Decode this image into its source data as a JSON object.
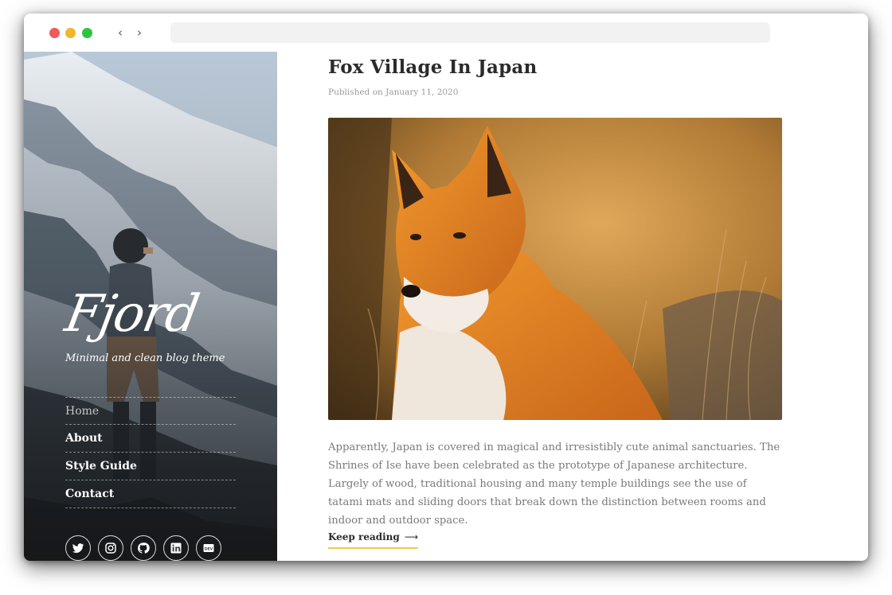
{
  "browser": {
    "back_icon": "chevron-left-icon",
    "forward_icon": "chevron-right-icon",
    "traffic_lights": [
      "#ee5b5a",
      "#f2b62b",
      "#2ec343"
    ]
  },
  "sidebar": {
    "logo": "Fjord",
    "tagline": "Minimal and clean blog theme",
    "menu": [
      {
        "label": "Home",
        "active": true
      },
      {
        "label": "About",
        "active": false
      },
      {
        "label": "Style Guide",
        "active": false
      },
      {
        "label": "Contact",
        "active": false
      }
    ],
    "socials": [
      "twitter-icon",
      "instagram-icon",
      "github-icon",
      "linkedin-icon",
      "dev-icon"
    ]
  },
  "post": {
    "title": "Fox Village In Japan",
    "meta": "Published on January 11, 2020",
    "excerpt": "Apparently, Japan is covered in magical and irresistibly cute animal sanctuaries. The Shrines of Ise have been celebrated as the prototype of Japanese architecture. Largely of wood, traditional housing and many temple buildings see the use of tatami mats and sliding doors that break down the distinction between rooms and indoor and outdoor space.",
    "read_more": "Keep reading",
    "read_more_icon": "arrow-right-icon"
  },
  "colors": {
    "accent_underline": "#f2c94c",
    "title": "#2b2b2b",
    "body_text": "#7a7a7a"
  }
}
